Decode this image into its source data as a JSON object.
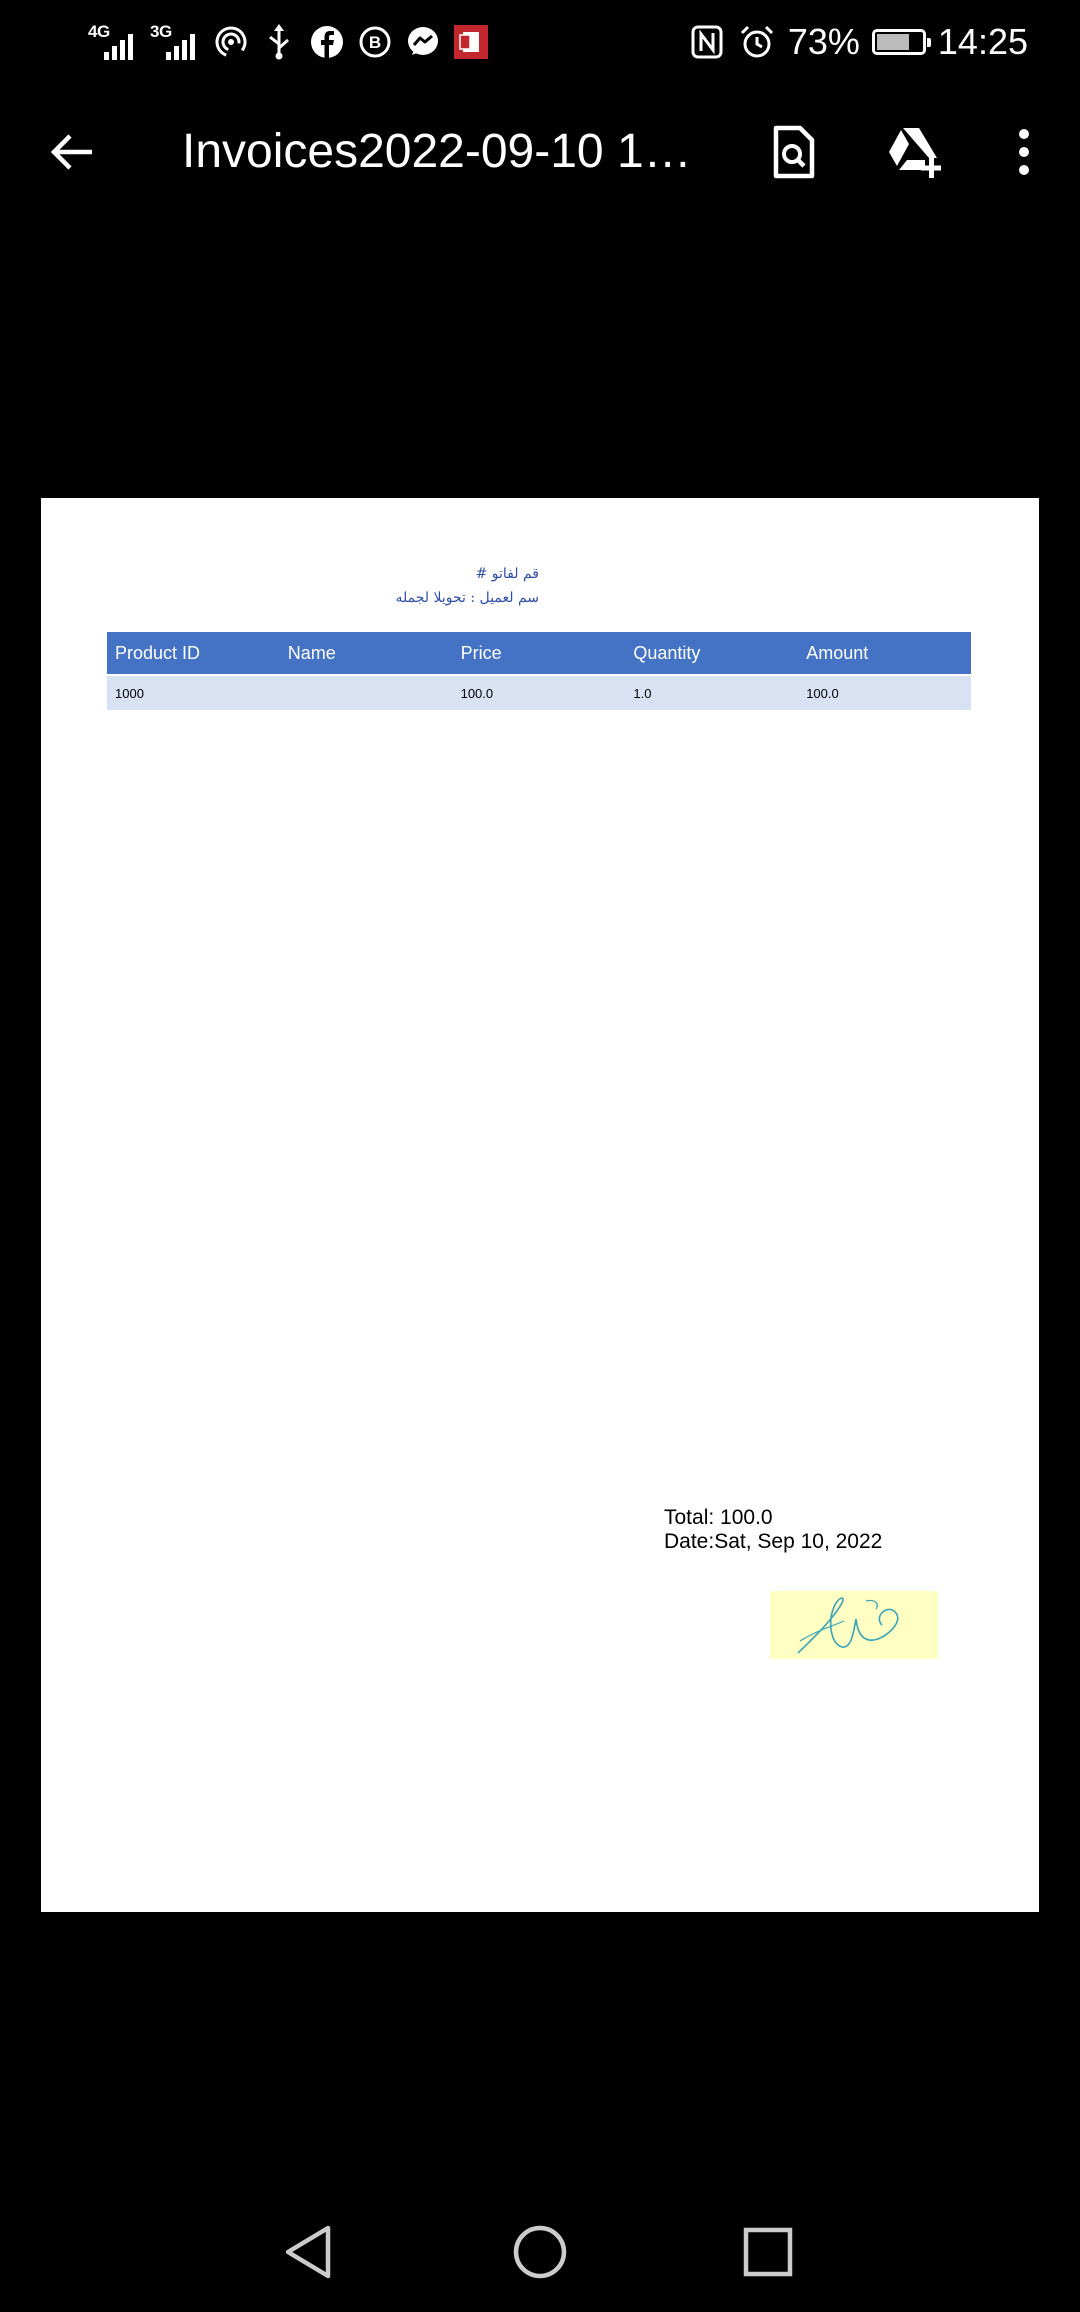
{
  "status_bar": {
    "network1_label": "4G",
    "network2_label": "3G",
    "battery_percent": "73%",
    "battery_level": 0.73,
    "time": "14:25",
    "left_icons": [
      "hotspot-icon",
      "usb-icon",
      "facebook-icon",
      "business-icon",
      "messenger-icon",
      "office-icon"
    ],
    "right_icons": [
      "nfc-icon",
      "alarm-icon",
      "battery-icon"
    ]
  },
  "app_bar": {
    "title": "Invoices2022-09-10 14:...",
    "icons": [
      "back-arrow-icon",
      "search-document-icon",
      "add-to-drive-icon",
      "more-options-icon"
    ]
  },
  "document": {
    "arabic_line1": "قم لفاتو #",
    "arabic_line2": "سم لعميل : تحويلا لجمله",
    "table": {
      "headers": [
        "Product ID",
        "Name",
        "Price",
        "Quantity",
        "Amount"
      ],
      "rows": [
        [
          "1000",
          "",
          "100.0",
          "1.0",
          "100.0"
        ]
      ]
    },
    "total_line": "Total: 100.0",
    "date_line": "Date:Sat, Sep 10, 2022"
  },
  "nav_bar": {
    "icons": [
      "back-triangle-icon",
      "home-circle-icon",
      "recents-square-icon"
    ]
  },
  "colors": {
    "table_header": "#4472c4",
    "table_row": "#d9e2f3",
    "arabic_text": "#2f4fa7",
    "signature_bg": "#ffffc4",
    "signature_ink": "#3aa3b8"
  }
}
